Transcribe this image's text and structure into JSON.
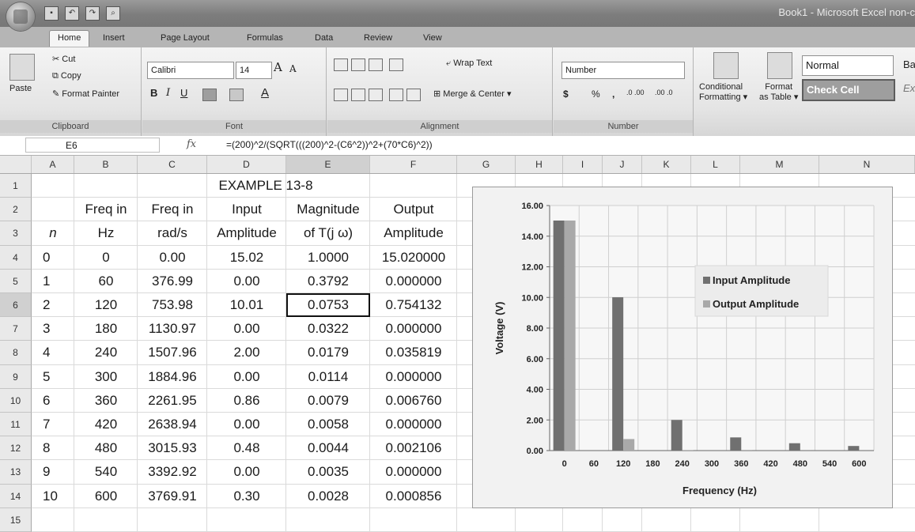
{
  "window": {
    "title": "Book1 - Microsoft Excel non-c",
    "quick_access": [
      "save-icon",
      "undo-icon",
      "redo-icon",
      "print-preview-icon"
    ]
  },
  "tabs": [
    "Home",
    "Insert",
    "Page Layout",
    "Formulas",
    "Data",
    "Review",
    "View"
  ],
  "ribbon": {
    "clipboard": {
      "paste": "Paste",
      "cut": "Cut",
      "copy": "Copy",
      "format_painter": "Format Painter",
      "label": "Clipboard"
    },
    "font": {
      "name": "Calibri",
      "size": "14",
      "bold": "B",
      "italic": "I",
      "underline": "U",
      "grow": "A",
      "shrink": "A",
      "color": "A",
      "label": "Font"
    },
    "alignment": {
      "wrap": "Wrap Text",
      "merge": "Merge & Center",
      "label": "Alignment"
    },
    "number": {
      "format": "Number",
      "currency": "$",
      "percent": "%",
      "comma": ",",
      "inc_dec": ".0 .00",
      "dec_dec": ".00 .0",
      "label": "Number"
    },
    "styles": {
      "conditional": "Conditional",
      "formatting": "Formatting",
      "format": "Format",
      "as_table": "as Table",
      "normal": "Normal",
      "check_cell": "Check Cell",
      "bad": "Ba",
      "explanatory": "Ex"
    }
  },
  "formula_bar": {
    "name_box": "E6",
    "fx": "fx",
    "formula": "=(200)^2/(SQRT(((200)^2-(C6^2))^2+(70*C6)^2))"
  },
  "columns": [
    "A",
    "B",
    "C",
    "D",
    "E",
    "F",
    "G",
    "H",
    "I",
    "J",
    "K",
    "L",
    "M",
    "N"
  ],
  "rows": [
    "1",
    "2",
    "3",
    "4",
    "5",
    "6",
    "7",
    "8",
    "9",
    "10",
    "11",
    "12",
    "13",
    "14",
    "15"
  ],
  "sheet": {
    "title": "EXAMPLE 13-8",
    "header_row2": [
      "",
      "Freq in",
      "Freq in",
      "Input",
      "Magnitude",
      "Output"
    ],
    "header_row3": [
      "n",
      "Hz",
      "rad/s",
      "Amplitude",
      "of T(j ω)",
      "Amplitude"
    ],
    "data": [
      [
        "0",
        "0",
        "0.00",
        "15.02",
        "1.0000",
        "15.020000"
      ],
      [
        "1",
        "60",
        "376.99",
        "0.00",
        "0.3792",
        "0.000000"
      ],
      [
        "2",
        "120",
        "753.98",
        "10.01",
        "0.0753",
        "0.754132"
      ],
      [
        "3",
        "180",
        "1130.97",
        "0.00",
        "0.0322",
        "0.000000"
      ],
      [
        "4",
        "240",
        "1507.96",
        "2.00",
        "0.0179",
        "0.035819"
      ],
      [
        "5",
        "300",
        "1884.96",
        "0.00",
        "0.0114",
        "0.000000"
      ],
      [
        "6",
        "360",
        "2261.95",
        "0.86",
        "0.0079",
        "0.006760"
      ],
      [
        "7",
        "420",
        "2638.94",
        "0.00",
        "0.0058",
        "0.000000"
      ],
      [
        "8",
        "480",
        "3015.93",
        "0.48",
        "0.0044",
        "0.002106"
      ],
      [
        "9",
        "540",
        "3392.92",
        "0.00",
        "0.0035",
        "0.000000"
      ],
      [
        "10",
        "600",
        "3769.91",
        "0.30",
        "0.0028",
        "0.000856"
      ]
    ],
    "selected_cell": "E6"
  },
  "chart_data": {
    "type": "bar",
    "categories": [
      "0",
      "60",
      "120",
      "180",
      "240",
      "300",
      "360",
      "420",
      "480",
      "540",
      "600"
    ],
    "series": [
      {
        "name": "Input Amplitude",
        "values": [
          15.02,
          0,
          10.01,
          0,
          2.0,
          0,
          0.86,
          0,
          0.48,
          0,
          0.3
        ],
        "color": "#707070"
      },
      {
        "name": "Output Amplitude",
        "values": [
          15.02,
          0,
          0.754132,
          0,
          0.035819,
          0,
          0.00676,
          0,
          0.002106,
          0,
          0.000856
        ],
        "color": "#a9a9a9"
      }
    ],
    "xlabel": "Frequency (Hz)",
    "ylabel": "Voltage (V)",
    "ylim": [
      0,
      16
    ],
    "yticks": [
      "0.00",
      "2.00",
      "4.00",
      "6.00",
      "8.00",
      "10.00",
      "12.00",
      "14.00",
      "16.00"
    ],
    "grid": true,
    "legend": "right"
  }
}
